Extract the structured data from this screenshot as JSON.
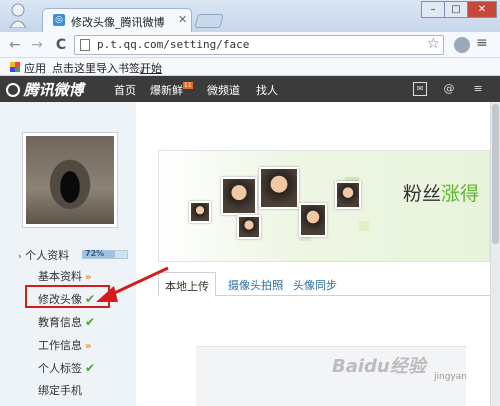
{
  "browser": {
    "tab_title": "修改头像_腾讯微博",
    "url": "p.t.qq.com/setting/face",
    "window_controls": {
      "close": "✕"
    },
    "bookmarks": {
      "apps_label": "应用",
      "import_label": "点击这里导入书签。",
      "start_label": "开始"
    }
  },
  "site": {
    "brand": "腾讯微博",
    "nav": {
      "home": "首页",
      "new": "爆新鲜",
      "new_badge": "11",
      "channel": "微频道",
      "people": "找人"
    }
  },
  "sidebar": {
    "profile_label": "个人资料",
    "progress_text": "72%",
    "progress_value": 0.72,
    "items": [
      {
        "label": "基本资料",
        "mark": "»"
      },
      {
        "label": "修改头像",
        "mark": "✔"
      },
      {
        "label": "教育信息",
        "mark": "✔"
      },
      {
        "label": "工作信息",
        "mark": "»"
      },
      {
        "label": "个人标签",
        "mark": "✔"
      },
      {
        "label": "绑定手机",
        "mark": ""
      }
    ]
  },
  "main": {
    "banner_text_1": "粉丝",
    "banner_text_2": "涨得",
    "tabs": [
      {
        "label": "本地上传"
      },
      {
        "label": "摄像头拍照"
      },
      {
        "label": "头像同步"
      }
    ]
  },
  "watermark": {
    "text": "Baidu经验",
    "sub": "jingyan"
  },
  "colors": {
    "highlight": "#d51c1c",
    "header_bg": "#3b3b3b",
    "check": "#46a82f",
    "chevron": "#f08a1c"
  }
}
